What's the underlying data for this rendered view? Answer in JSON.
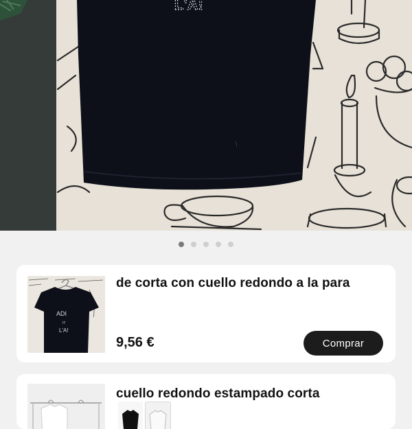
{
  "hero": {
    "shirt_print": "L'A!",
    "carousel": {
      "total": 5,
      "active_index": 0
    }
  },
  "products": [
    {
      "title": "de corta con cuello redondo a la para",
      "price": "9,56 €",
      "buy_label": "Comprar",
      "thumb_text": [
        "ADI",
        "IT",
        "L'A!"
      ]
    },
    {
      "title": "cuello redondo estampado corta"
    }
  ],
  "colors": {
    "page_background": "#f1f1f1",
    "card_background": "#ffffff",
    "button_background": "#1c1c1c",
    "button_text": "#ffffff",
    "dot_active": "#7a7a7a",
    "dot_inactive": "#cfcfcf"
  }
}
